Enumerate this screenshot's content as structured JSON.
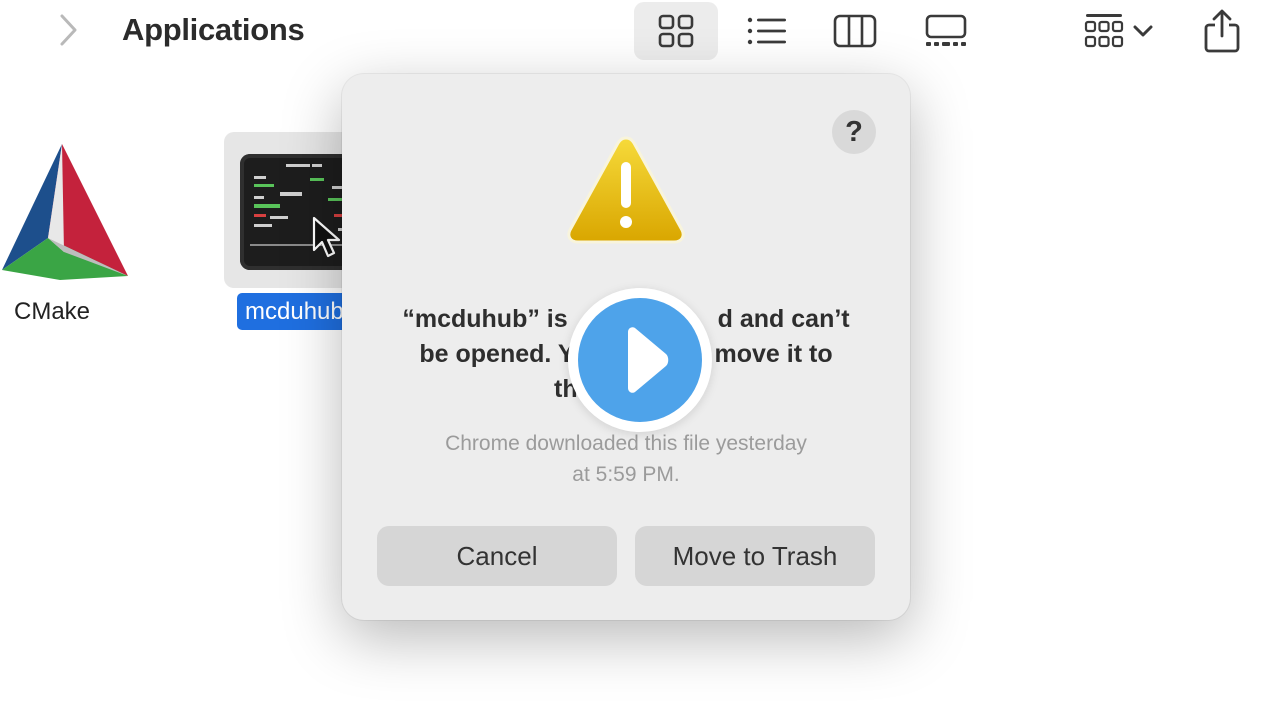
{
  "toolbar": {
    "title": "Applications",
    "icons": {
      "forward": "chevron-right-icon",
      "view_icons": "grid-view-icon",
      "view_list": "list-view-icon",
      "view_columns": "column-view-icon",
      "view_gallery": "gallery-view-icon",
      "group": "group-by-icon",
      "group_menu": "chevron-down-icon",
      "share": "share-icon"
    }
  },
  "files": [
    {
      "name": "CMake",
      "icon": "cmake-app-icon",
      "selected": false
    },
    {
      "name": "mcduhub",
      "icon": "mcduhub-app-icon",
      "selected": true
    }
  ],
  "dialog": {
    "help_label": "?",
    "icon": "warning-icon",
    "message_line1": "“mcduhub” is",
    "message_line1_end": "d and can’t",
    "message_line2": "be opened. Y",
    "message_line2_end": "move it to",
    "message_line3": "th",
    "info_line1": "Chrome downloaded this file yesterday",
    "info_line2": "at 5:59 PM.",
    "cancel_label": "Cancel",
    "trash_label": "Move to Trash"
  },
  "overlay": {
    "icon": "play-icon"
  },
  "colors": {
    "selection": "#1f6fe0",
    "warning_top": "#f2d02e",
    "warning_bottom": "#d6a400",
    "play_blue": "#4ea3ea"
  }
}
